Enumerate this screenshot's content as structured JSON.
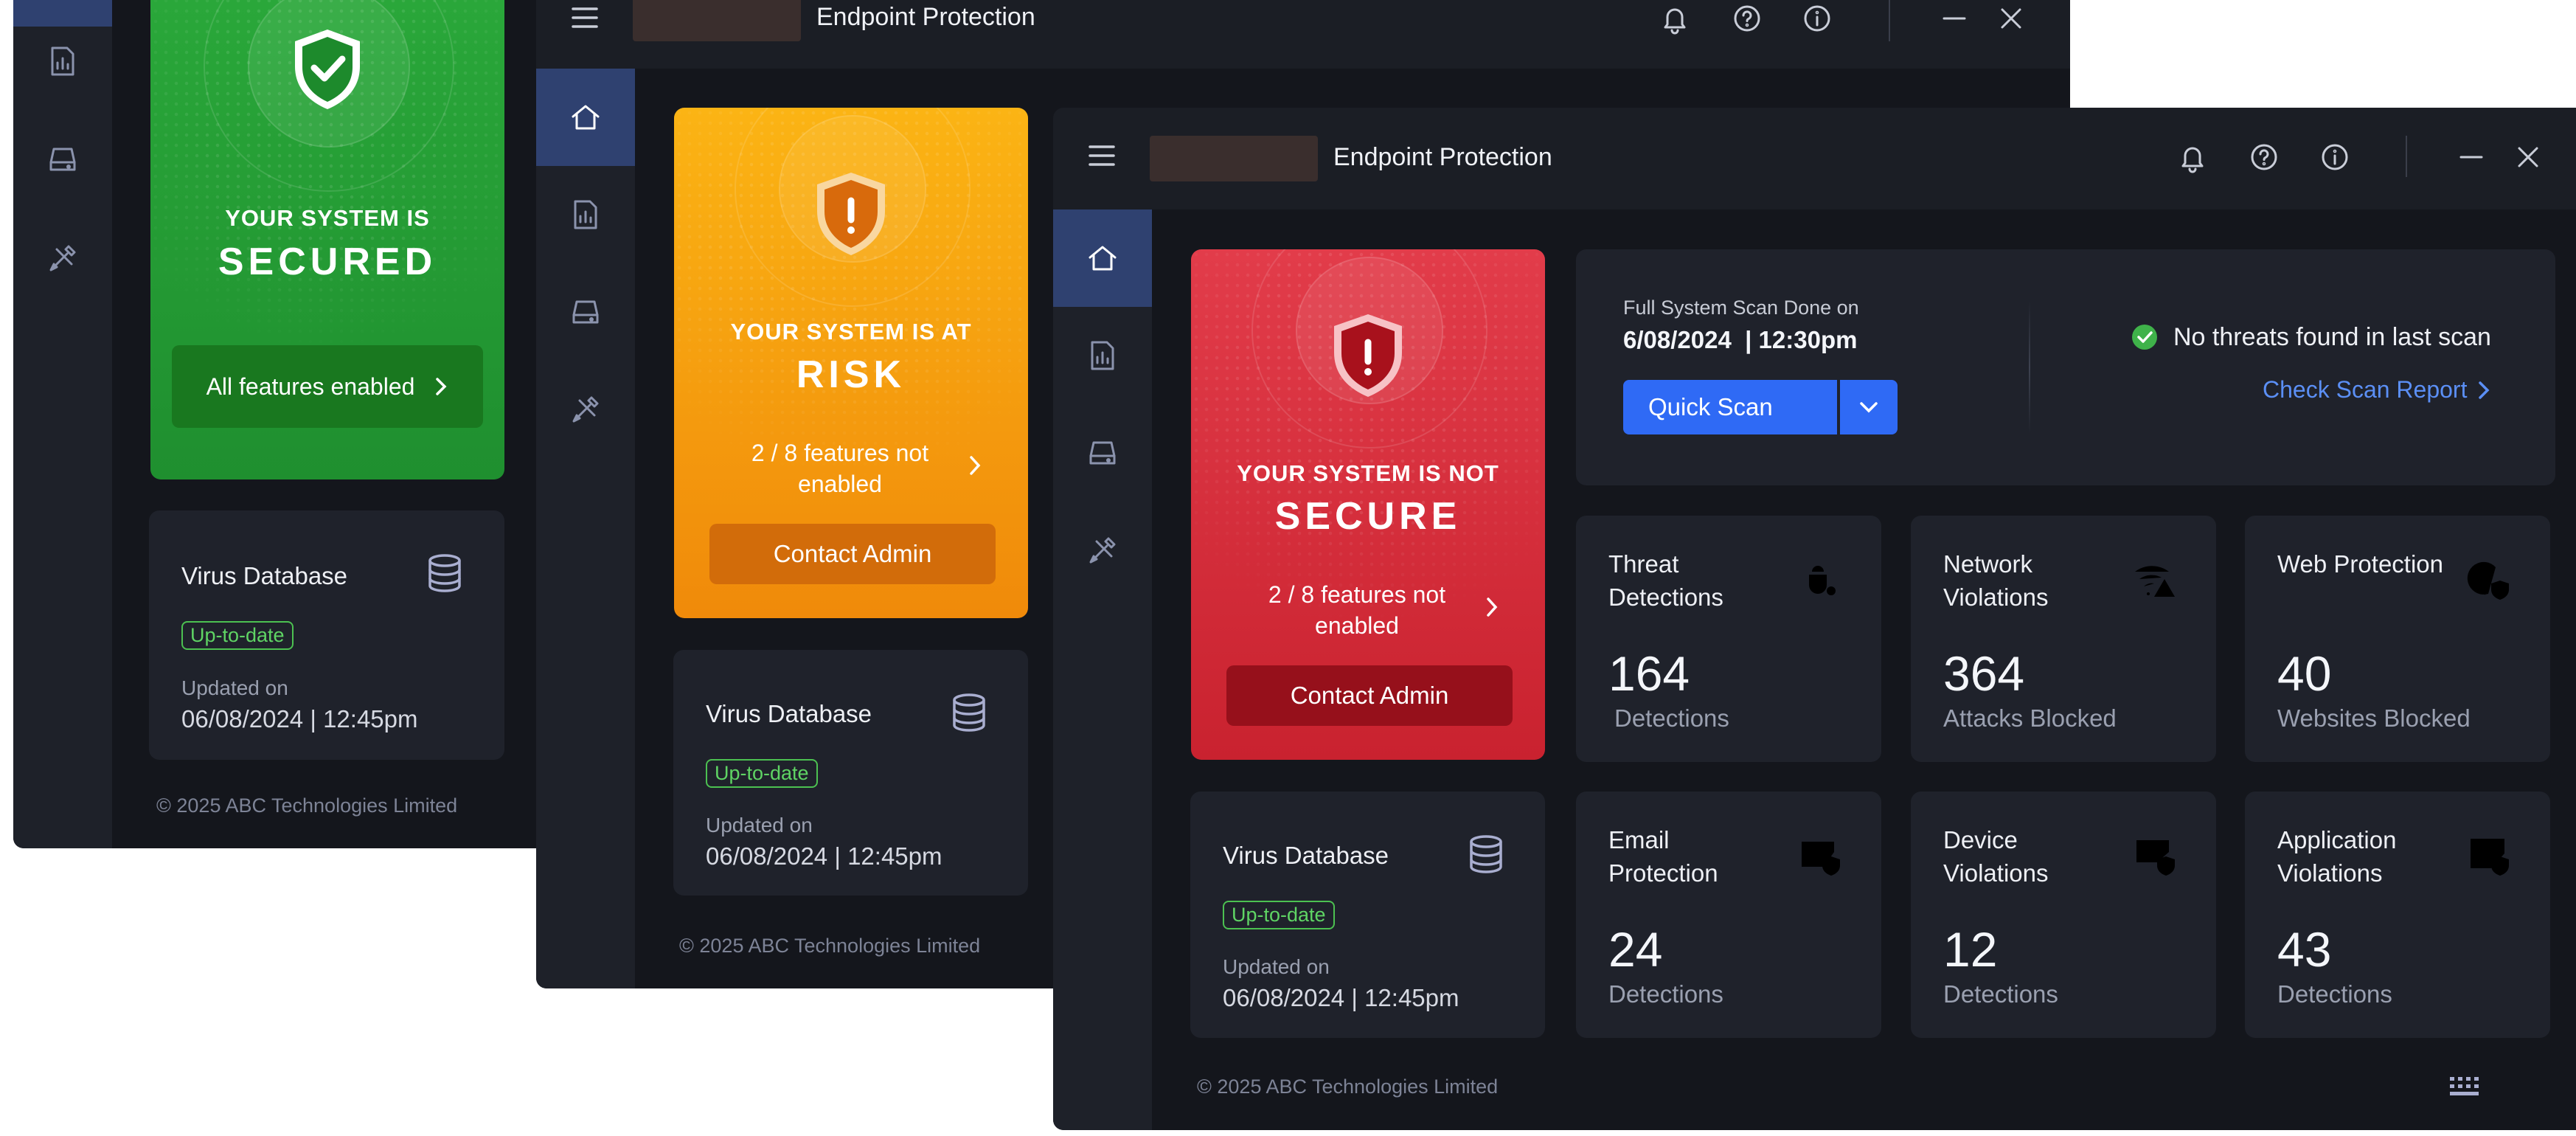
{
  "app": {
    "title": "Endpoint Protection",
    "footer": "© 2025 ABC Technologies Limited"
  },
  "colors": {
    "secured": "#27a53a",
    "at_risk": "#f7a21a",
    "not_secure": "#e03846",
    "accent": "#2f6af5",
    "link": "#5b8ff5",
    "success": "#4cc151"
  },
  "sidebar_icons": [
    "home-icon",
    "report-icon",
    "drive-icon",
    "tools-icon"
  ],
  "titlebar_icons": [
    "bell-icon",
    "help-icon",
    "info-icon",
    "minimize-icon",
    "close-icon"
  ],
  "win1": {
    "status_line1": "YOUR SYSTEM IS",
    "status_line2": "SECURED",
    "features_button": "All features enabled",
    "vdb_title": "Virus Database",
    "vdb_badge": "Up-to-date",
    "vdb_updated_label": "Updated on",
    "vdb_updated_value": "06/08/2024 | 12:45pm"
  },
  "win2": {
    "status_line1": "YOUR SYSTEM IS AT",
    "status_line2": "RISK",
    "features_note": "2 / 8 features not enabled",
    "contact_button": "Contact Admin",
    "vdb_title": "Virus Database",
    "vdb_badge": "Up-to-date",
    "vdb_updated_label": "Updated on",
    "vdb_updated_value": "06/08/2024 | 12:45pm"
  },
  "win3": {
    "status_line1": "YOUR SYSTEM IS NOT",
    "status_line2": "SECURE",
    "features_note": "2 / 8 features not enabled",
    "contact_button": "Contact Admin",
    "scan": {
      "done_label": "Full System Scan Done on",
      "done_value": "6/08/2024  | 12:30pm",
      "quick_scan_button": "Quick Scan",
      "no_threats": "No threats found in last scan",
      "report_link": "Check Scan Report"
    },
    "metrics": [
      {
        "title": "Threat Detections",
        "value": "164",
        "unit": "Detections",
        "icon": "bug-target-icon"
      },
      {
        "title": "Network Violations",
        "value": "364",
        "unit": "Attacks Blocked",
        "icon": "wifi-warning-icon"
      },
      {
        "title": "Web Protection",
        "value": "40",
        "unit": "Websites Blocked",
        "icon": "globe-shield-icon"
      },
      {
        "title": "Email Protection",
        "value": "24",
        "unit": "Detections",
        "icon": "mail-shield-icon"
      },
      {
        "title": "Device Violations",
        "value": "12",
        "unit": "Detections",
        "icon": "device-shield-icon"
      },
      {
        "title": "Application Violations",
        "value": "43",
        "unit": "Detections",
        "icon": "app-shield-icon"
      }
    ],
    "vdb_title": "Virus Database",
    "vdb_badge": "Up-to-date",
    "vdb_updated_label": "Updated on",
    "vdb_updated_value": "06/08/2024 | 12:45pm"
  }
}
